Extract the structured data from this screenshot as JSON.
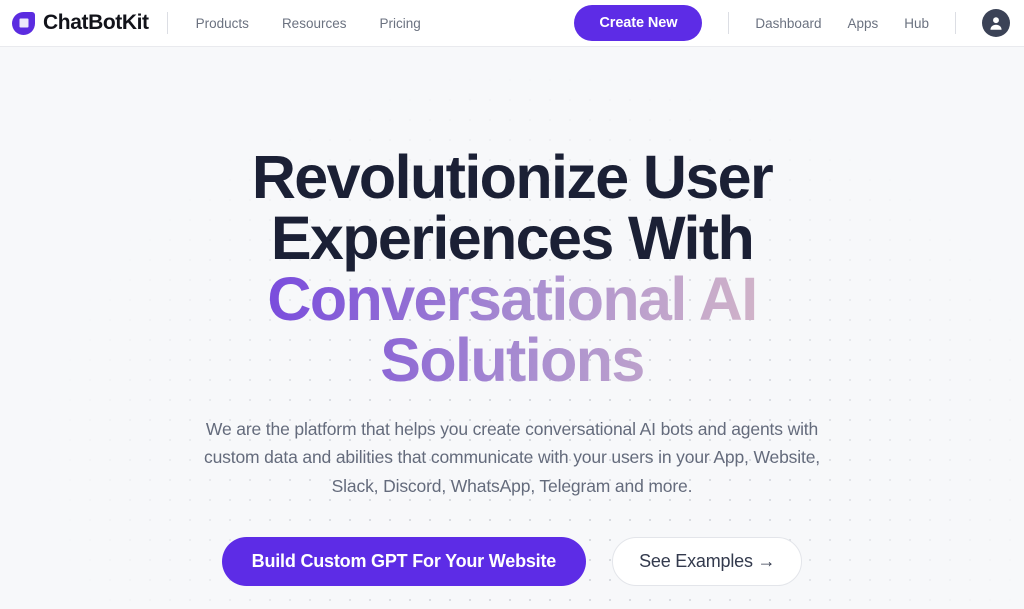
{
  "brand": {
    "name": "ChatBotKit",
    "logo_icon": "chatbotkit-droplet-logo-icon",
    "accent_color": "#5b2ce0"
  },
  "header": {
    "nav_left": [
      {
        "label": "Products"
      },
      {
        "label": "Resources"
      },
      {
        "label": "Pricing"
      }
    ],
    "create_button": {
      "label": "Create New",
      "color": "#5d2ce6"
    },
    "nav_right": [
      {
        "label": "Dashboard"
      },
      {
        "label": "Apps"
      },
      {
        "label": "Hub"
      }
    ],
    "avatar_icon": "user-avatar-icon"
  },
  "hero": {
    "headline": {
      "line1": "Revolutionize User",
      "line2": "Experiences With",
      "line3": "Conversational AI",
      "line4": "Solutions",
      "dark_color": "#1b2035",
      "gradient_from": "#5b2ce0",
      "gradient_to": "#edcccd"
    },
    "subcopy": "We are the platform that helps you create conversational AI bots and agents with custom data and abilities that communicate with your users in your App, Website, Slack, Discord, WhatsApp, Telegram and more.",
    "primary_cta": {
      "label": "Build Custom GPT For Your Website"
    },
    "secondary_cta": {
      "label": "See Examples →"
    }
  }
}
